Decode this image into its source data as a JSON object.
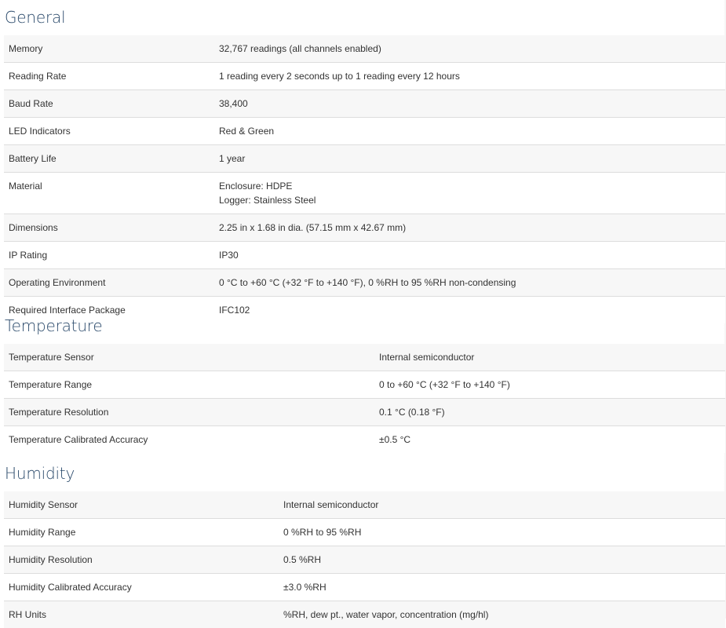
{
  "general": {
    "title": "General",
    "rows": [
      {
        "label": "Memory",
        "value": "32,767 readings (all channels enabled)"
      },
      {
        "label": "Reading Rate",
        "value": "1 reading every 2 seconds up to 1 reading every 12 hours"
      },
      {
        "label": "Baud Rate",
        "value": "38,400"
      },
      {
        "label": "LED Indicators",
        "value": "Red & Green"
      },
      {
        "label": "Battery Life",
        "value": "1 year"
      },
      {
        "label": "Material",
        "value": "Enclosure: HDPE",
        "value2": "Logger: Stainless Steel"
      },
      {
        "label": "Dimensions",
        "value": "2.25 in x 1.68 in dia. (57.15 mm x 42.67 mm)"
      },
      {
        "label": "IP Rating",
        "value": "IP30"
      },
      {
        "label": "Operating Environment",
        "value": "0 °C to +60 °C (+32 °F to +140 °F), 0 %RH to 95 %RH non-condensing"
      },
      {
        "label": "Required Interface Package",
        "value": "IFC102"
      }
    ]
  },
  "temperature": {
    "title": "Temperature",
    "rows": [
      {
        "label": "Temperature Sensor",
        "value": "Internal semiconductor"
      },
      {
        "label": "Temperature Range",
        "value": "0 to +60 °C (+32 °F to +140 °F)"
      },
      {
        "label": "Temperature Resolution",
        "value": "0.1 °C (0.18 °F)"
      },
      {
        "label": "Temperature Calibrated Accuracy",
        "value": "±0.5 °C"
      }
    ]
  },
  "humidity": {
    "title": "Humidity",
    "rows": [
      {
        "label": "Humidity Sensor",
        "value": "Internal semiconductor"
      },
      {
        "label": "Humidity Range",
        "value": "0 %RH to 95 %RH"
      },
      {
        "label": "Humidity Resolution",
        "value": "0.5 %RH"
      },
      {
        "label": "Humidity Calibrated Accuracy",
        "value": "±3.0 %RH"
      },
      {
        "label": "RH Units",
        "value": "%RH, dew pt., water vapor, concentration (mg/hl)"
      }
    ]
  }
}
